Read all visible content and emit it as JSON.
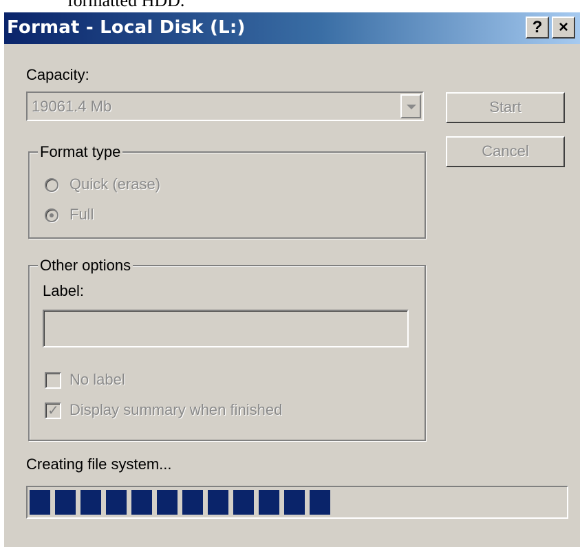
{
  "page_caption": "formatted HDD.",
  "window": {
    "title": "Format - Local Disk (L:)",
    "help_label": "?",
    "close_label": "×"
  },
  "capacity": {
    "label": "Capacity:",
    "value": "19061.4 Mb"
  },
  "buttons": {
    "start": "Start",
    "cancel": "Cancel"
  },
  "format_type": {
    "legend": "Format type",
    "options": [
      {
        "label": "Quick (erase)",
        "selected": false
      },
      {
        "label": "Full",
        "selected": true
      }
    ]
  },
  "other_options": {
    "legend": "Other options",
    "label_field_label": "Label:",
    "label_value": "",
    "no_label": {
      "label": "No label",
      "checked": false
    },
    "display_summary": {
      "label": "Display summary when finished",
      "checked": true
    }
  },
  "status": {
    "text": "Creating file system...",
    "progress_fraction": 0.57
  },
  "colors": {
    "title_start": "#0a246a",
    "title_end": "#a6caf0",
    "face": "#d4d0c8",
    "progress_block": "#0a246a"
  }
}
